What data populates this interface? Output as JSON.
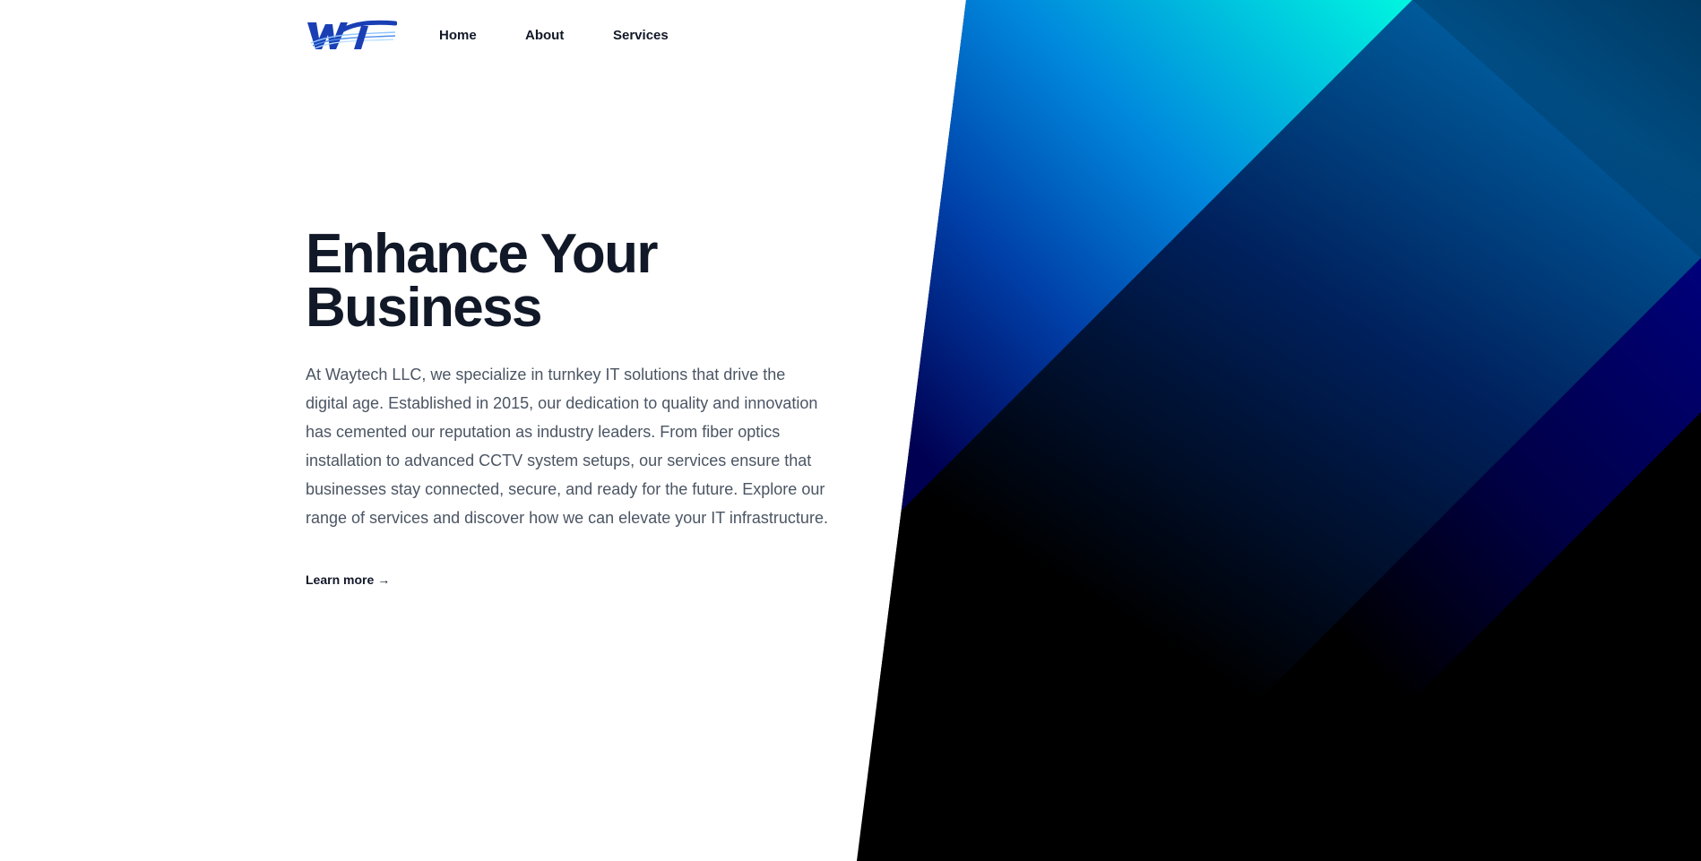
{
  "nav": {
    "logo_text": "WT",
    "items": [
      {
        "label": "Home"
      },
      {
        "label": "About"
      },
      {
        "label": "Services"
      }
    ]
  },
  "hero": {
    "title_line1": "Enhance Your",
    "title_line2": "Business",
    "description": "At Waytech LLC, we specialize in turnkey IT solutions that drive the digital age. Established in 2015, our dedication to quality and innovation has cemented our reputation as industry leaders. From fiber optics installation to advanced CCTV system setups, our services ensure that businesses stay connected, secure, and ready for the future. Explore our range of services and discover how we can elevate your IT infrastructure.",
    "cta_label": "Learn more",
    "cta_arrow": "→"
  },
  "colors": {
    "heading": "#111827",
    "body_text": "#4b5563",
    "brand_blue": "#1a3fb5",
    "accent_cyan": "#00f5e0",
    "deep_navy": "#00006e"
  }
}
